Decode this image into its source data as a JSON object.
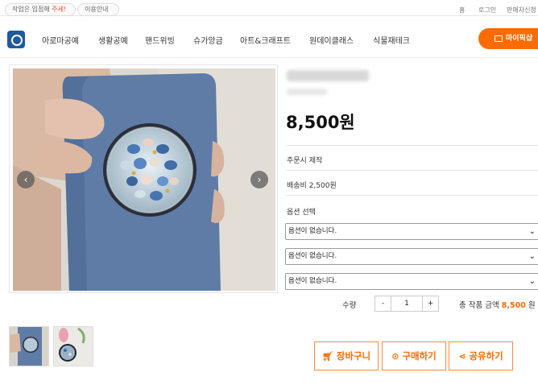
{
  "topbar": {
    "notice": {
      "prefix": "작업은 입점해 ",
      "highlight": "주세!"
    },
    "guide_label": "이용안내",
    "links": [
      "홈",
      "로그인",
      "판매자신청"
    ]
  },
  "nav": {
    "items": [
      "아로마공예",
      "생활공예",
      "핸드위빙",
      "슈가앙금",
      "아트&크래프트",
      "원데이클래스",
      "식물재테크"
    ],
    "partner_label": "마이픽샵"
  },
  "product": {
    "price": "8,500원",
    "made_to_order": "주문시 제작",
    "shipping": "배송비 2,500원",
    "option_title": "옵션 선택",
    "options": [
      "옵션이 없습니다.",
      "옵션이 없습니다.",
      "옵션이 없습니다."
    ],
    "qty_label": "수량",
    "qty_value": "1",
    "minus": "-",
    "plus": "+",
    "total_label": "총 작품 금액 ",
    "total_amount": "8,500",
    "total_suffix": " 원"
  },
  "gallery": {
    "prev": "‹",
    "next": "›"
  },
  "actions": {
    "cart": "장바구니",
    "buy": "구매하기",
    "share": "공유하기"
  },
  "colors": {
    "accent": "#ff6b00",
    "logo": "#1e5a9c"
  },
  "icons": [
    "cart-icon",
    "coin-icon",
    "share-icon",
    "chevron-down-icon",
    "prev-arrow-icon",
    "next-arrow-icon"
  ]
}
